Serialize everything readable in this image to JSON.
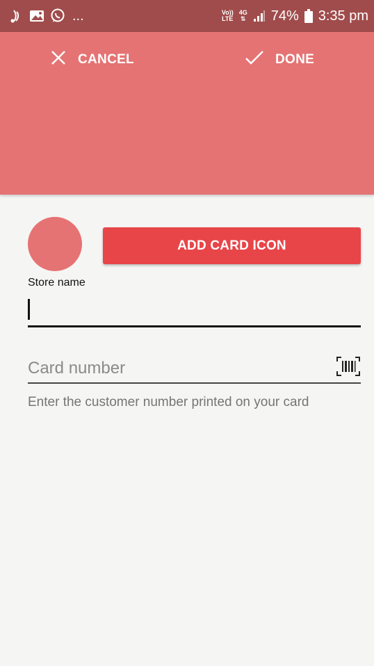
{
  "status_bar": {
    "ellipsis": "...",
    "network_top": "Vo))",
    "network_bottom": "LTE",
    "data_top": "4G",
    "battery": "74%",
    "time": "3:35 pm"
  },
  "appbar": {
    "cancel_label": "CANCEL",
    "done_label": "DONE"
  },
  "form": {
    "add_icon_label": "ADD CARD ICON",
    "store_name_label": "Store name",
    "store_name_value": "",
    "card_number_placeholder": "Card number",
    "helper_text": "Enter the customer number printed on your card"
  },
  "colors": {
    "status_bar": "#a04c4c",
    "appbar": "#e57373",
    "accent_button": "#e84549",
    "background": "#f5f5f3"
  },
  "icons": [
    "nfc-icon",
    "image-icon",
    "whatsapp-icon",
    "signal-icon",
    "battery-icon",
    "close-icon",
    "check-icon",
    "barcode-icon"
  ]
}
